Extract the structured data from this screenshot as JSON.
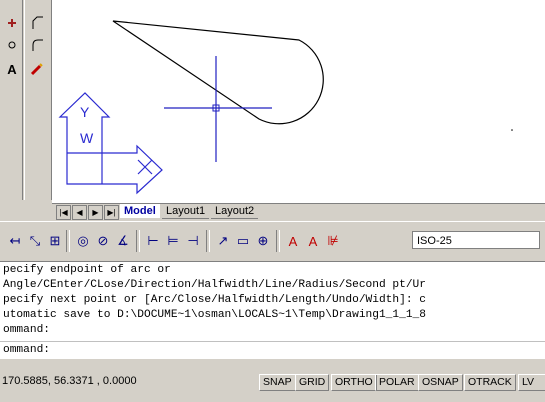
{
  "layout_tabs": [
    "Model",
    "Layout1",
    "Layout2"
  ],
  "dimstyle": "ISO-25",
  "command_history": [
    "pecify endpoint of arc or",
    "Angle/CEnter/CLose/Direction/Halfwidth/Line/Radius/Second pt/Ur",
    "pecify next point or [Arc/Close/Halfwidth/Length/Undo/Width]: c",
    "utomatic save to D:\\DOCUME~1\\osman\\LOCALS~1\\Temp\\Drawing1_1_1_8",
    "ommand:"
  ],
  "command_prompt": "ommand:",
  "coordinates": "170.5885, 56.3371 , 0.0000",
  "status_buttons": [
    "SNAP",
    "GRID",
    "ORTHO",
    "POLAR",
    "OSNAP",
    "OTRACK",
    "LV"
  ],
  "ucs_labels": {
    "y": "Y",
    "w": "W"
  },
  "colors": {
    "crosshair": "#2020c0",
    "ucs": "#2a2ad0",
    "accent": "#0000a0"
  }
}
